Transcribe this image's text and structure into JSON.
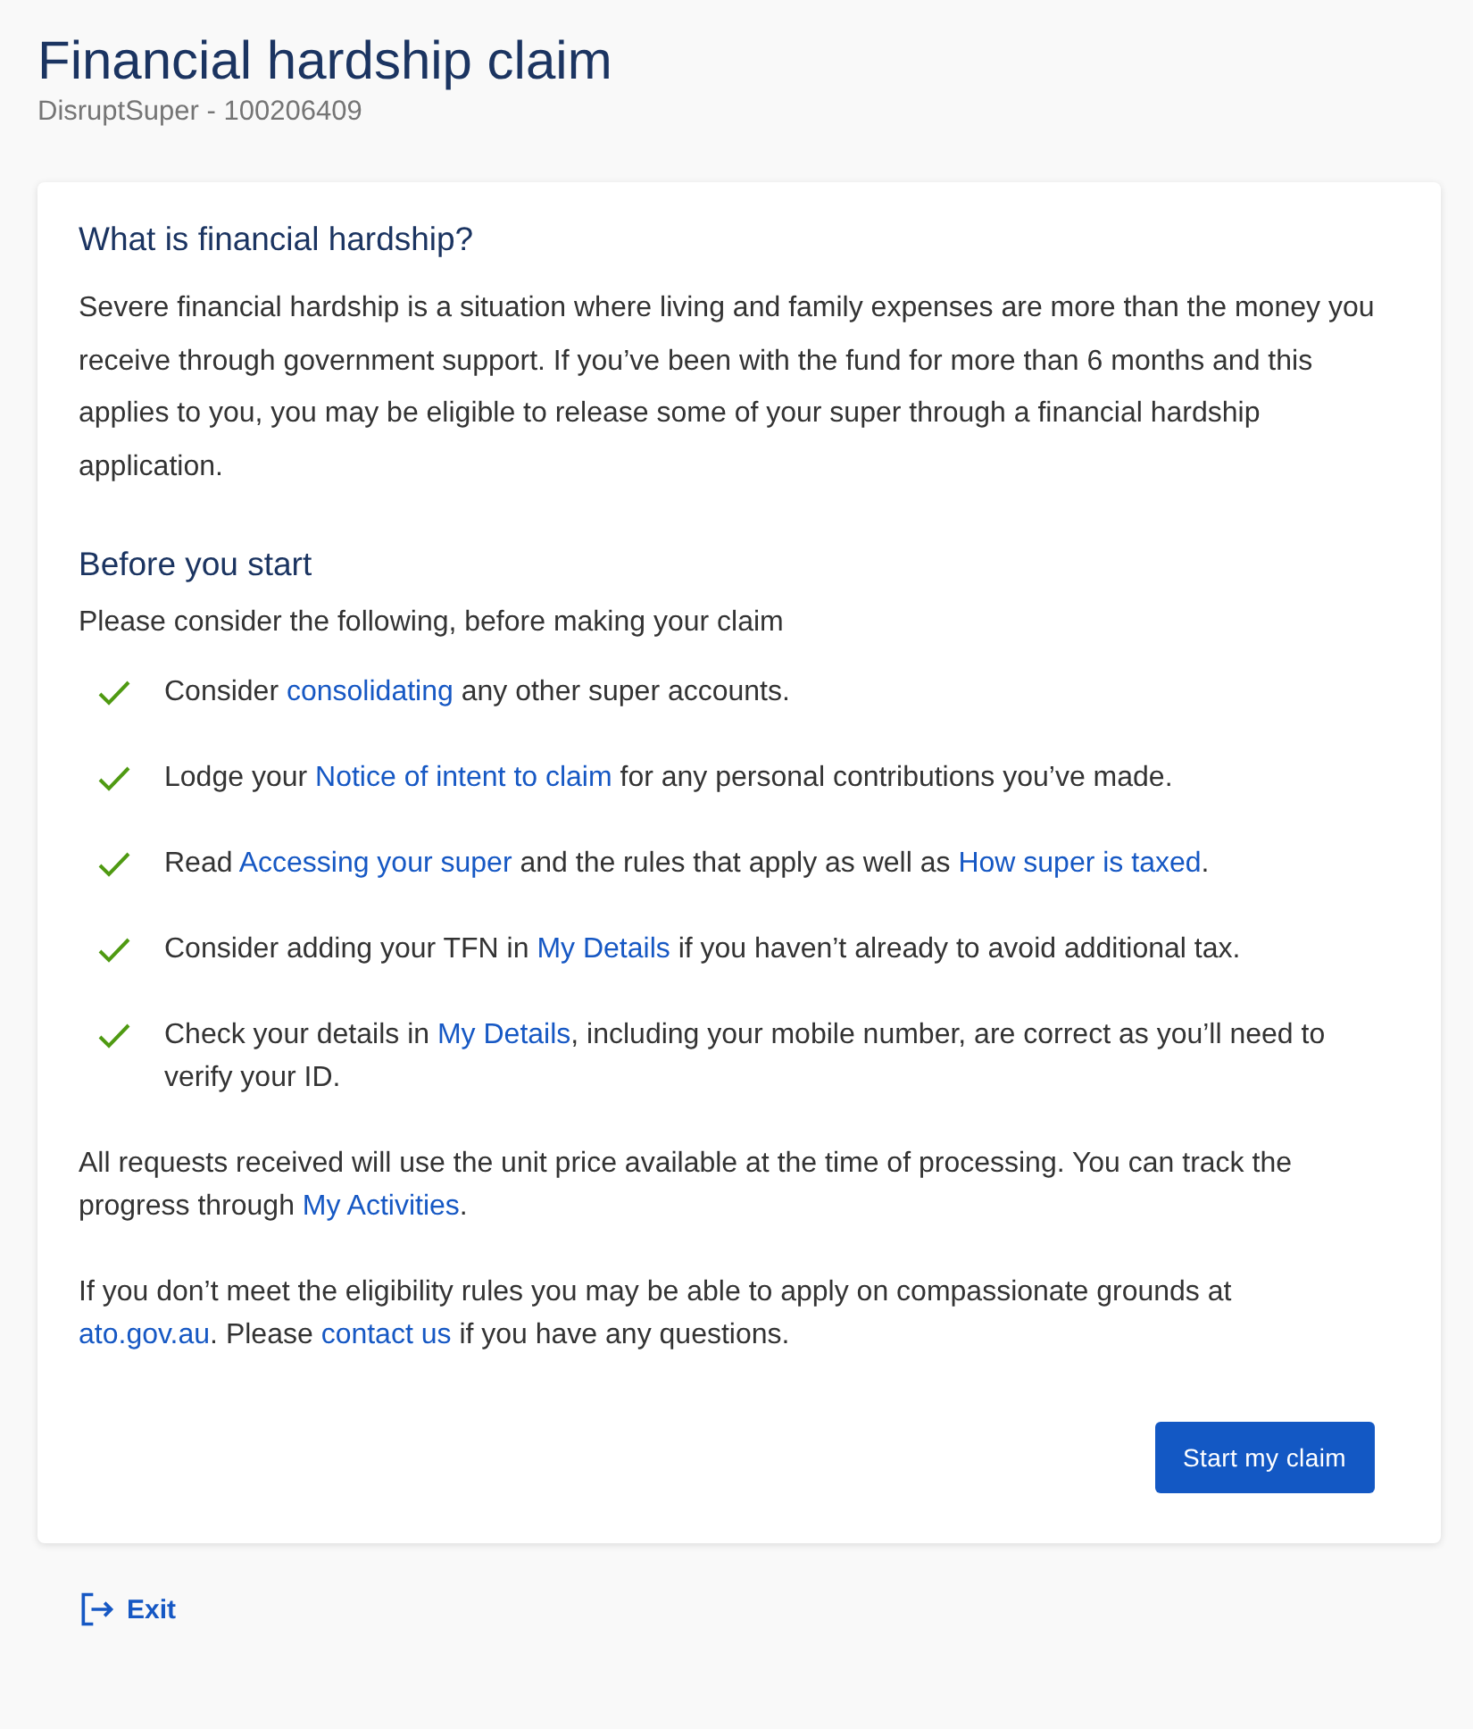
{
  "page": {
    "title": "Financial hardship claim",
    "subtitle": "DisruptSuper - 100206409"
  },
  "card": {
    "sections": [
      {
        "heading": "What is financial hardship?",
        "intro": "Severe financial hardship is a situation where living and family expenses are more than the money you receive through government support. If you’ve been with the fund for more than 6 months and this applies to you, you may be eligible to release some of your super through a financial hardship application."
      },
      {
        "heading": "Before you start",
        "intro": "Please consider the following, before making your claim"
      }
    ],
    "checklist": [
      {
        "checked": true,
        "parts": [
          {
            "text": "Consider ",
            "kind": "text"
          },
          {
            "text": "consolidating",
            "kind": "link"
          },
          {
            "text": " any other super accounts.",
            "kind": "text"
          }
        ]
      },
      {
        "checked": true,
        "parts": [
          {
            "text": "Lodge your ",
            "kind": "text"
          },
          {
            "text": "Notice of intent to claim",
            "kind": "link"
          },
          {
            "text": " for any personal contributions you’ve made.",
            "kind": "text"
          }
        ]
      },
      {
        "checked": true,
        "parts": [
          {
            "text": "Read ",
            "kind": "text"
          },
          {
            "text": "Accessing your super",
            "kind": "link"
          },
          {
            "text": " and the rules that apply as well as ",
            "kind": "text"
          },
          {
            "text": "How super is taxed",
            "kind": "link"
          },
          {
            "text": ".",
            "kind": "text"
          }
        ]
      },
      {
        "checked": true,
        "parts": [
          {
            "text": "Consider adding your TFN in ",
            "kind": "text"
          },
          {
            "text": "My Details",
            "kind": "link"
          },
          {
            "text": " if you haven’t already to avoid additional tax.",
            "kind": "text"
          }
        ]
      },
      {
        "checked": true,
        "parts": [
          {
            "text": "Check your details in ",
            "kind": "text"
          },
          {
            "text": "My Details",
            "kind": "link"
          },
          {
            "text": ", including your mobile number, are correct as you’ll need to verify your ID.",
            "kind": "text"
          }
        ]
      }
    ],
    "notes": [
      [
        {
          "text": "All requests received will use the unit price available at the time of processing. You can track the progress through ",
          "kind": "text"
        },
        {
          "text": "My Activities",
          "kind": "link"
        },
        {
          "text": ".",
          "kind": "text"
        }
      ],
      [
        {
          "text": "If you don’t meet the eligibility rules you may be able to apply on compassionate grounds at ",
          "kind": "text"
        },
        {
          "text": "ato.gov.au",
          "kind": "link"
        },
        {
          "text": ". Please ",
          "kind": "text"
        },
        {
          "text": "contact us",
          "kind": "link"
        },
        {
          "text": " if you have any questions.",
          "kind": "text"
        }
      ]
    ],
    "button": "Start my claim"
  },
  "exit": "Exit"
}
